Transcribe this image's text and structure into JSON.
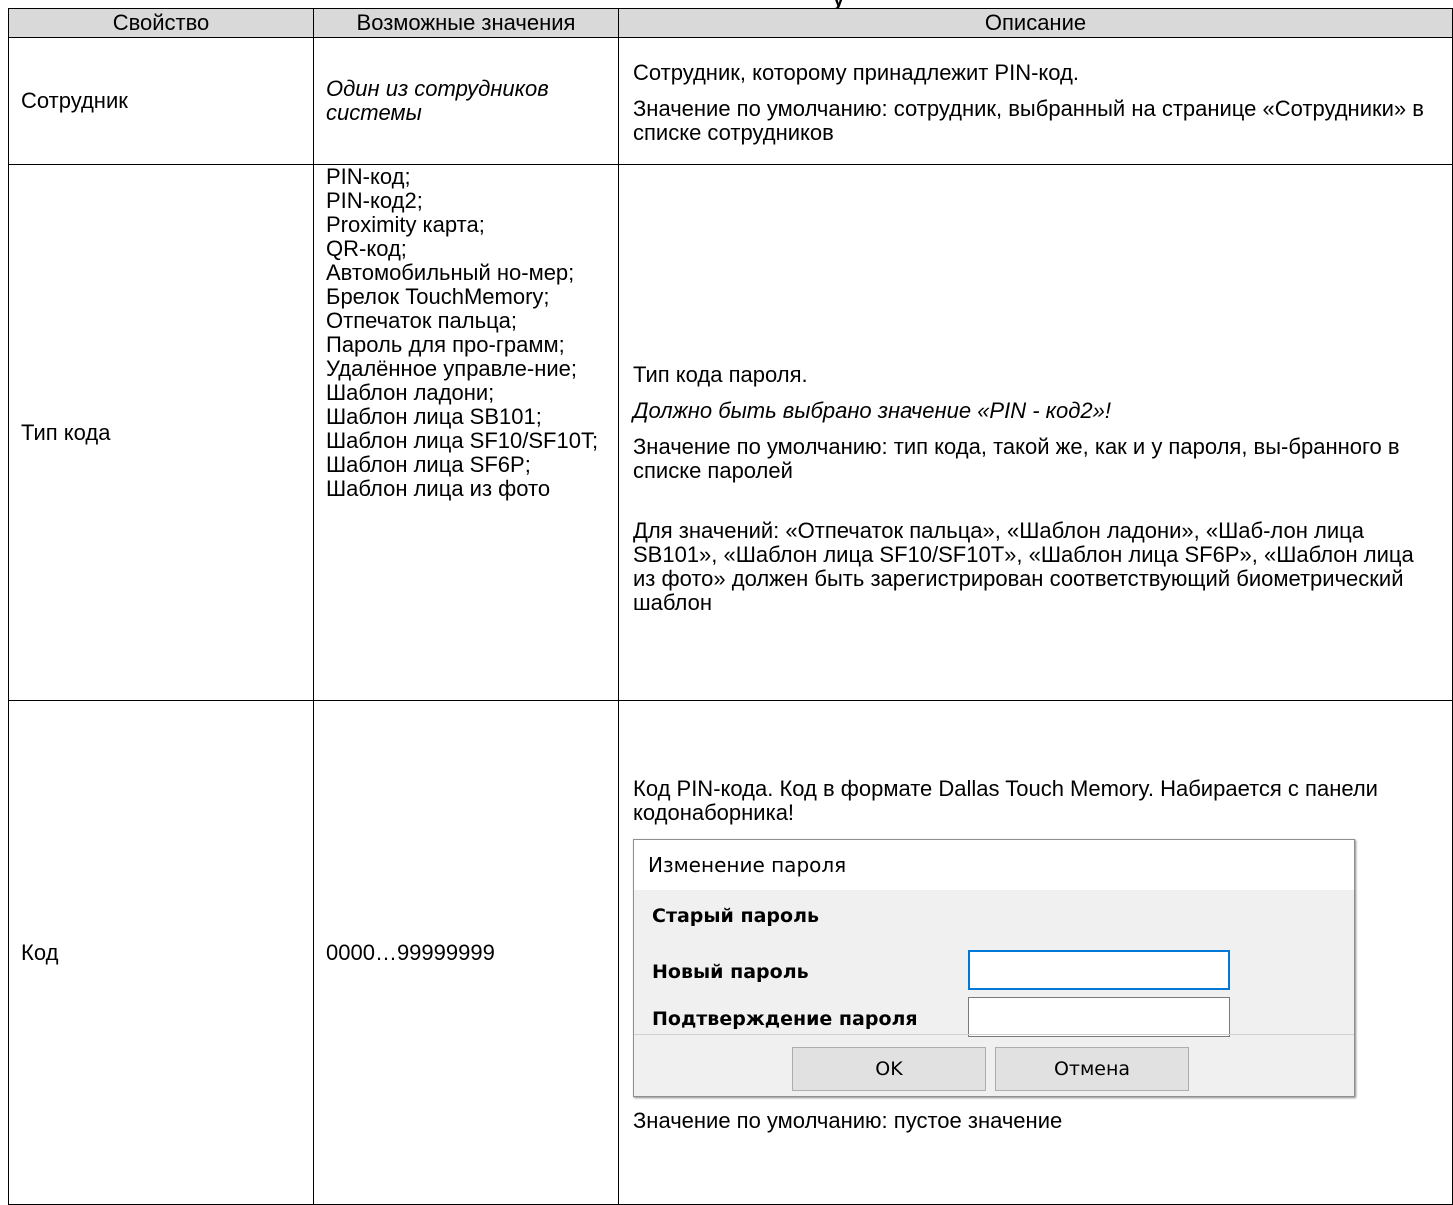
{
  "page_top_fragment": "у",
  "table": {
    "headers": [
      "Свойство",
      "Возможные значения",
      "Описание"
    ],
    "rows": [
      {
        "property": "Сотрудник",
        "values_text": "Один из сотрудников системы",
        "desc": [
          "Сотрудник, которому принадлежит PIN-код.",
          "Значение по умолчанию: сотрудник, выбранный на странице «Сотрудники» в списке сотрудников"
        ]
      },
      {
        "property": "Тип кода",
        "values_list": [
          "PIN-код;",
          "PIN-код2;",
          "Proximity карта;",
          "QR-код;",
          "Автомобильный но-мер;",
          "Брелок TouchMemory;",
          "Отпечаток пальца;",
          "Пароль для про-грамм;",
          "Удалённое управле-ние;",
          "Шаблон ладони;",
          "Шаблон лица SB101;",
          "Шаблон лица SF10/SF10T;",
          "Шаблон лица SF6P;",
          "Шаблон лица из фото"
        ],
        "desc": [
          "Тип кода пароля.",
          "Должно быть выбрано значение «PIN - код2»!",
          "Значение по умолчанию: тип кода, такой же, как и у пароля, вы-бранного в списке паролей",
          "Для значений: «Отпечаток пальца», «Шаблон ладони», «Шаб-лон лица SB101», «Шаблон лица SF10/SF10T», «Шаблон лица SF6P», «Шаблон лица из фото» должен быть зарегистрирован соответствующий биометрический шаблон"
        ]
      },
      {
        "property": "Код",
        "values_text": "0000…99999999",
        "desc": [
          "Код PIN-кода. Код в формате Dallas Touch Memory. Набирается с панели кодонаборника!",
          "Значение по умолчанию: пустое значение"
        ]
      }
    ]
  },
  "dialog": {
    "title": "Изменение пароля",
    "old_password_label": "Старый пароль",
    "new_password_label": "Новый пароль",
    "confirm_password_label": "Подтверждение пароля",
    "new_password_value": "",
    "confirm_password_value": "",
    "ok_label": "OK",
    "cancel_label": "Отмена",
    "focus_color": "#0078d7"
  }
}
